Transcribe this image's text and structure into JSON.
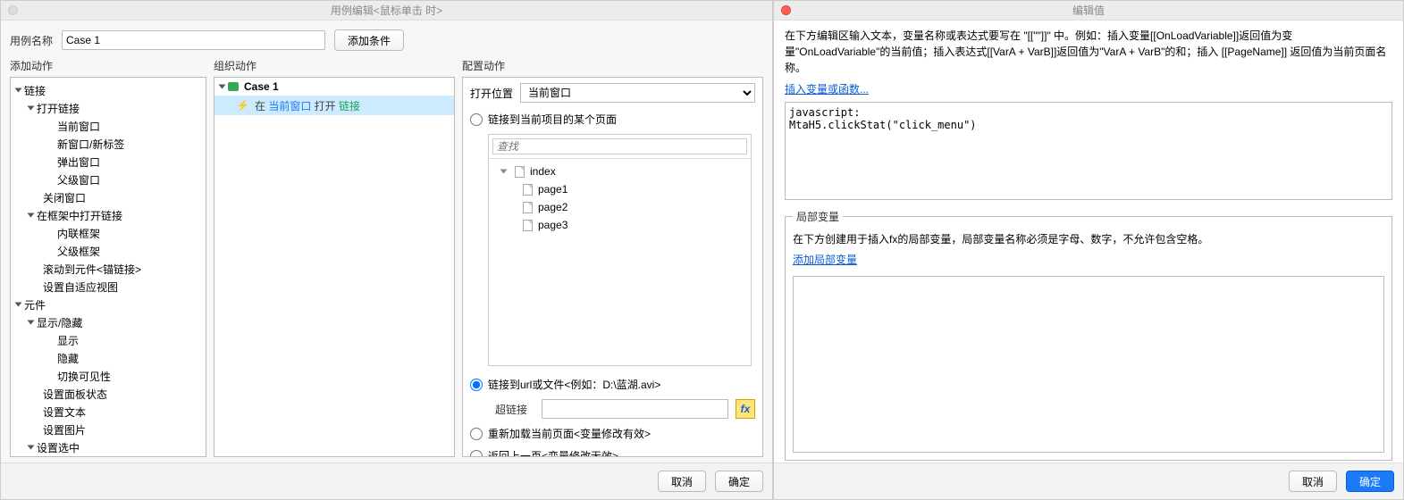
{
  "left": {
    "title": "用例编辑<鼠标单击 时>",
    "caseLabel": "用例名称",
    "caseName": "Case 1",
    "addCondition": "添加条件",
    "headers": {
      "add": "添加动作",
      "org": "组织动作",
      "cfg": "配置动作"
    },
    "actionsTree": {
      "links": "链接",
      "openLink": "打开链接",
      "curWin": "当前窗口",
      "newWin": "新窗口/新标签",
      "popWin": "弹出窗口",
      "parentWin": "父级窗口",
      "closeWin": "关闭窗口",
      "openInFrame": "在框架中打开链接",
      "inlineFrame": "内联框架",
      "parentFrame": "父级框架",
      "scrollTo": "滚动到元件<锚链接>",
      "adaptive": "设置自适应视图",
      "widgets": "元件",
      "showHide": "显示/隐藏",
      "show": "显示",
      "hide": "隐藏",
      "toggleVis": "切换可见性",
      "panelState": "设置面板状态",
      "setText": "设置文本",
      "setImage": "设置图片",
      "setSelected": "设置选中"
    },
    "org": {
      "case": "Case 1",
      "action": {
        "pre": "在",
        "win": "当前窗口",
        "mid": "打开",
        "what": "链接"
      }
    },
    "cfg": {
      "openAtLabel": "打开位置",
      "openAtValue": "当前窗口",
      "radioPage": "链接到当前项目的某个页面",
      "searchPh": "查找",
      "pages": {
        "root": "index",
        "p1": "page1",
        "p2": "page2",
        "p3": "page3"
      },
      "radioUrl": "链接到url或文件<例如：D:\\蓝湖.avi>",
      "hyperLabel": "超链接",
      "radioReload": "重新加载当前页面<变量修改有效>",
      "radioBack": "返回上一页<变量修改无效>"
    },
    "footer": {
      "cancel": "取消",
      "ok": "确定"
    }
  },
  "right": {
    "title": "编辑值",
    "intro": "在下方编辑区输入文本，变量名称或表达式要写在 \"[[\"\"]]\" 中。例如：插入变量[[OnLoadVariable]]返回值为变量\"OnLoadVariable\"的当前值；插入表达式[[VarA + VarB]]返回值为\"VarA + VarB\"的和；插入 [[PageName]] 返回值为当前页面名称。",
    "insertLink": "插入变量或函数...",
    "code": "javascript:\nMtaH5.clickStat(\"click_menu\")",
    "localVarsTitle": "局部变量",
    "localVarsHelp": "在下方创建用于插入fx的局部变量，局部变量名称必须是字母、数字，不允许包含空格。",
    "addLocalVar": "添加局部变量",
    "cancel": "取消",
    "ok": "确定"
  }
}
